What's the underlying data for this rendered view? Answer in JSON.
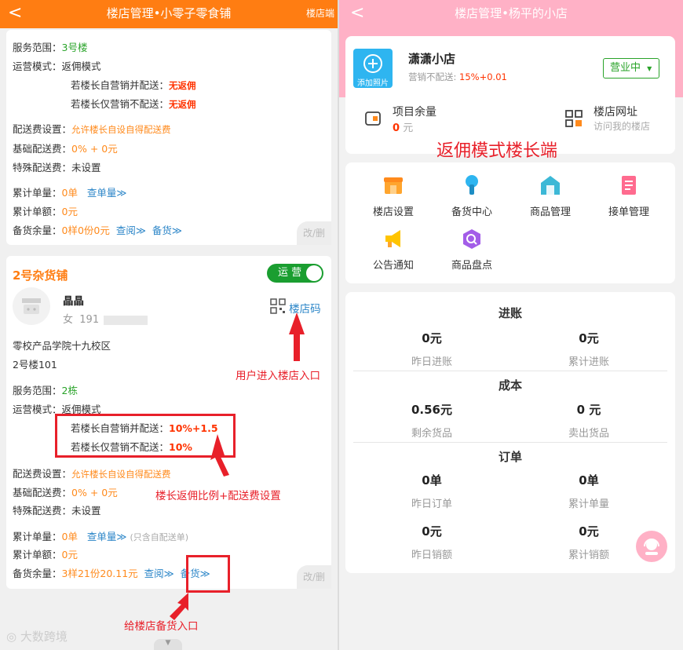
{
  "left": {
    "header": {
      "back": "<",
      "title": "楼店管理•小零子零食铺",
      "right_label": "楼店端"
    },
    "card1": {
      "service_label": "服务范围：",
      "service_value": "3号楼",
      "mode_label": "运营模式：",
      "mode_value": "返佣模式",
      "self_label": "若楼长自营销并配送：",
      "self_value": "无返佣",
      "only_label": "若楼长仅营销不配送：",
      "only_value": "无返佣",
      "fee_label": "配送费设置：",
      "fee_value": "允许楼长自设自得配送费",
      "base_label": "基础配送费：",
      "base_value": "0% + 0元",
      "special_label": "特殊配送费：",
      "special_value": "未设置",
      "orders_label": "累计单量：",
      "orders_value": "0单",
      "orders_link": "查单量≫",
      "amount_label": "累计单额：",
      "amount_value": "0元",
      "stock_label": "备货余量：",
      "stock_value": "0样0份0元",
      "stock_query": "查阅≫",
      "stock_link": "备货≫",
      "edit": "改/删"
    },
    "card2": {
      "name": "2号杂货铺",
      "toggle": "运 营",
      "owner_name": "晶晶",
      "owner_gender": "女",
      "owner_phone": "191",
      "qr_label": "楼店码",
      "address1": "零校产品学院十九校区",
      "address2": "2号楼101",
      "service_label": "服务范围：",
      "service_value": "2栋",
      "mode_label": "运营模式：",
      "mode_value": "返佣模式",
      "self_label": "若楼长自营销并配送：",
      "self_value": "10%+1.5",
      "only_label": "若楼长仅营销不配送：",
      "only_value": "10%",
      "fee_label": "配送费设置：",
      "fee_value": "允许楼长自设自得配送费",
      "base_label": "基础配送费：",
      "base_value": "0% + 0元",
      "special_label": "特殊配送费：",
      "special_value": "未设置",
      "orders_label": "累计单量：",
      "orders_value": "0单",
      "orders_link": "查单量≫",
      "orders_note": "(只含自配送单)",
      "amount_label": "累计单额：",
      "amount_value": "0元",
      "stock_label": "备货余量：",
      "stock_value": "3样21份20.11元",
      "stock_query": "查阅≫",
      "stock_link": "备货≫",
      "edit": "改/删"
    },
    "annotations": {
      "user_entry": "用户进入楼店入口",
      "commission": "楼长返佣比例+配送费设置",
      "stock_entry": "给楼店备货入口"
    },
    "watermark": "大数跨境"
  },
  "right": {
    "header": {
      "back": "<",
      "title": "楼店管理•杨平的小店"
    },
    "shop": {
      "add_photo": "添加照片",
      "name": "潇潇小店",
      "sub_label": "营销不配送:",
      "sub_value": "15%+0.01",
      "status": "营业中",
      "balance_label": "项目余量",
      "balance_value": "0",
      "balance_unit": "元",
      "url_label": "楼店网址",
      "url_sub": "访问我的楼店"
    },
    "annotation": "返佣模式楼长端",
    "menu": [
      {
        "label": "楼店设置",
        "icon": "shop-icon"
      },
      {
        "label": "备货中心",
        "icon": "stock-icon"
      },
      {
        "label": "商品管理",
        "icon": "goods-icon"
      },
      {
        "label": "接单管理",
        "icon": "orders-icon"
      },
      {
        "label": "公告通知",
        "icon": "megaphone-icon"
      },
      {
        "label": "商品盘点",
        "icon": "inventory-icon"
      }
    ],
    "stats": {
      "income_title": "进账",
      "income": [
        {
          "value": "0元",
          "label": "昨日进账"
        },
        {
          "value": "0元",
          "label": "累计进账"
        }
      ],
      "cost_title": "成本",
      "cost": [
        {
          "value": "0.56元",
          "label": "剩余货品"
        },
        {
          "value": "0 元",
          "label": "卖出货品"
        }
      ],
      "order_title": "订单",
      "orders": [
        {
          "value": "0单",
          "label": "昨日订单"
        },
        {
          "value": "0单",
          "label": "累计单量"
        }
      ],
      "sales": [
        {
          "value": "0元",
          "label": "昨日销额"
        },
        {
          "value": "0元",
          "label": "累计销额"
        }
      ]
    }
  },
  "colors": {
    "orange_header": "#ff7d12",
    "pink_header": "#ffb1c6",
    "green": "#29a329",
    "red": "#ff3300",
    "annotation": "#e8202a"
  }
}
